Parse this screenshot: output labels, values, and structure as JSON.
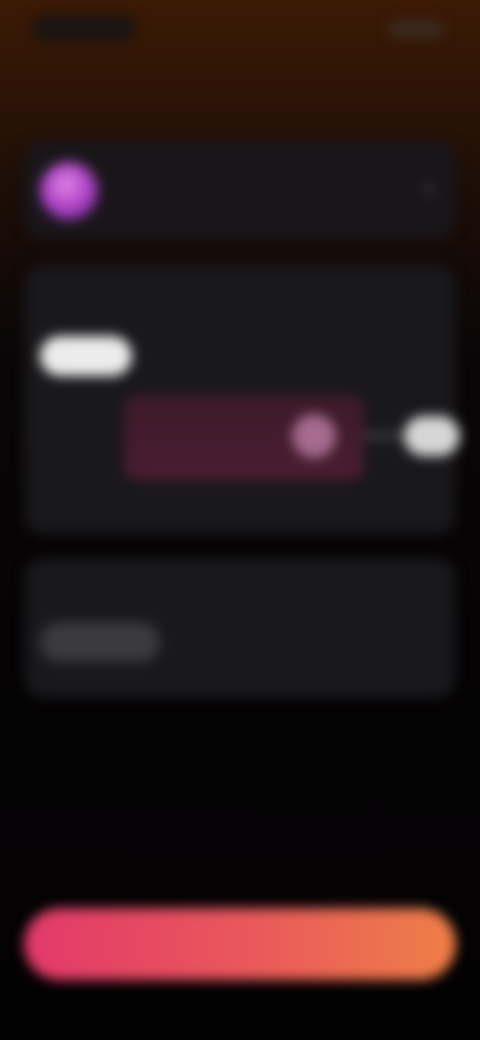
{
  "status_bar": {
    "time": "",
    "icons": [
      "signal-icon",
      "wifi-icon",
      "battery-icon"
    ]
  },
  "header": {
    "title": ""
  },
  "profile": {
    "name": "",
    "subtitle": ""
  },
  "card_primary": {
    "heading": "",
    "selected_option": "",
    "secondary_option": "",
    "slider_caption": ""
  },
  "card_secondary": {
    "heading": "",
    "selected_option": "",
    "secondary_option": ""
  },
  "cta": {
    "label": ""
  },
  "colors": {
    "accent_start": "#e2396a",
    "accent_end": "#ee8048",
    "avatar": "#b146c9",
    "background": "#050203",
    "card": "#19181b"
  }
}
